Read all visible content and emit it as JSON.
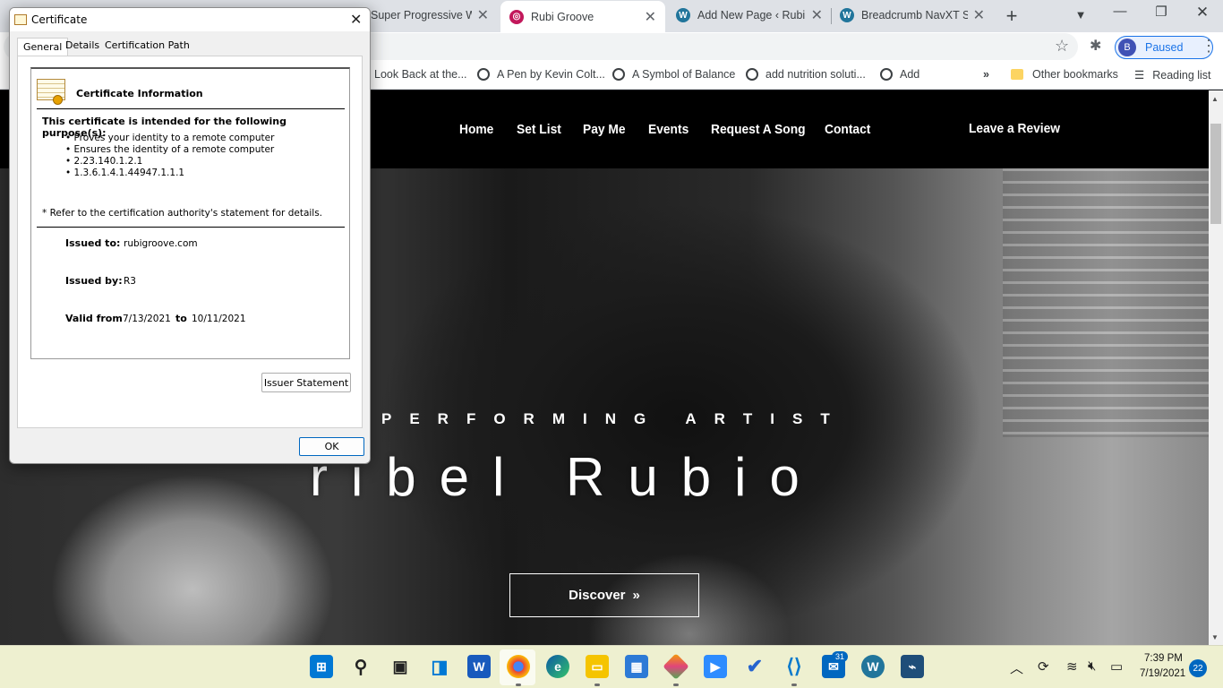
{
  "browser": {
    "tabs": [
      {
        "label": "Super Progressive Wel",
        "favicon_color": "#7e57c2"
      },
      {
        "label": "Rubi Groove",
        "favicon_color": "#c2185b",
        "active": true
      },
      {
        "label": "Add New Page ‹ Rubi",
        "favicon_color": "#21759b"
      },
      {
        "label": "Breadcrumb NavXT Se",
        "favicon_color": "#21759b"
      }
    ],
    "profile_initial": "B",
    "profile_status": "Paused",
    "bookmarks": [
      "Look Back at the...",
      "A Pen by Kevin Colt...",
      "A Symbol of Balance",
      "add nutrition soluti...",
      "Add"
    ],
    "bookmarks_overflow": "»",
    "other_bookmarks": "Other bookmarks",
    "reading_list": "Reading list"
  },
  "site": {
    "nav": [
      "Home",
      "Set List",
      "Pay Me",
      "Events",
      "Request A Song",
      "Contact"
    ],
    "review": "Leave a Review",
    "hero_subtitle": "PERFORMING ARTIST",
    "hero_title": "ribel Rubio",
    "cta_label": "Discover",
    "cta_icon": "»"
  },
  "dialog": {
    "title": "Certificate",
    "tabs": [
      "General",
      "Details",
      "Certification Path"
    ],
    "heading": "Certificate Information",
    "purpose_heading": "This certificate is intended for the following purpose(s):",
    "purposes": [
      "• Proves your identity to a remote computer",
      "• Ensures the identity of a remote computer",
      "• 2.23.140.1.2.1",
      "• 1.3.6.1.4.1.44947.1.1.1"
    ],
    "footnote": "* Refer to the certification authority's statement for details.",
    "issued_to_label": "Issued to:",
    "issued_to": "rubigroove.com",
    "issued_by_label": "Issued by:",
    "issued_by": "R3",
    "valid_from_label": "Valid from",
    "valid_from": "7/13/2021",
    "valid_to_label": "to",
    "valid_to": "10/11/2021",
    "issuer_button": "Issuer Statement",
    "ok_button": "OK"
  },
  "taskbar": {
    "mail_badge": "31",
    "time": "7:39 PM",
    "date": "7/19/2021",
    "notifications": "22"
  },
  "colors": {
    "accent": "#1a73e8",
    "nav_bg": "#000000",
    "taskbar_bg": "#eef0d0"
  }
}
